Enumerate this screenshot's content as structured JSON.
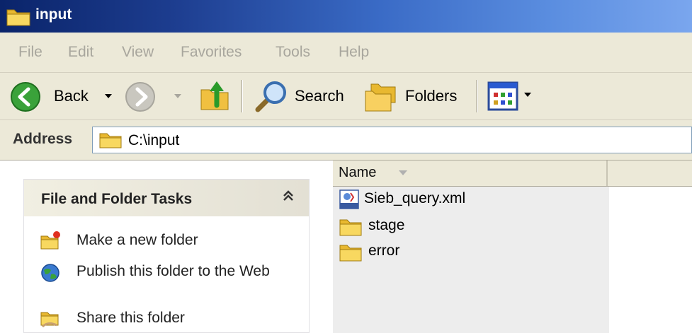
{
  "window": {
    "title": "input"
  },
  "menu": {
    "items": [
      "File",
      "Edit",
      "View",
      "Favorites",
      "Tools",
      "Help"
    ]
  },
  "toolbar": {
    "back_label": "Back",
    "search_label": "Search",
    "folders_label": "Folders"
  },
  "address": {
    "label": "Address",
    "value": "C:\\input"
  },
  "tasks": {
    "title": "File and Folder Tasks",
    "collapse_glyph": "ˆ",
    "items": [
      {
        "label": "Make a new folder",
        "icon": "new-folder-icon"
      },
      {
        "label": "Publish this folder to the Web",
        "icon": "globe-icon"
      },
      {
        "label": "Share this folder",
        "icon": "share-folder-icon"
      }
    ]
  },
  "filelist": {
    "columns": [
      {
        "label": "Name",
        "sorted": true
      }
    ],
    "items": [
      {
        "name": "Sieb_query.xml",
        "icon": "xml-file-icon"
      },
      {
        "name": "stage",
        "icon": "folder-icon"
      },
      {
        "name": "error",
        "icon": "folder-icon"
      }
    ]
  },
  "colors": {
    "title_bar": "#0a246a",
    "chrome": "#ece9d8",
    "folder": "#f0c040"
  }
}
